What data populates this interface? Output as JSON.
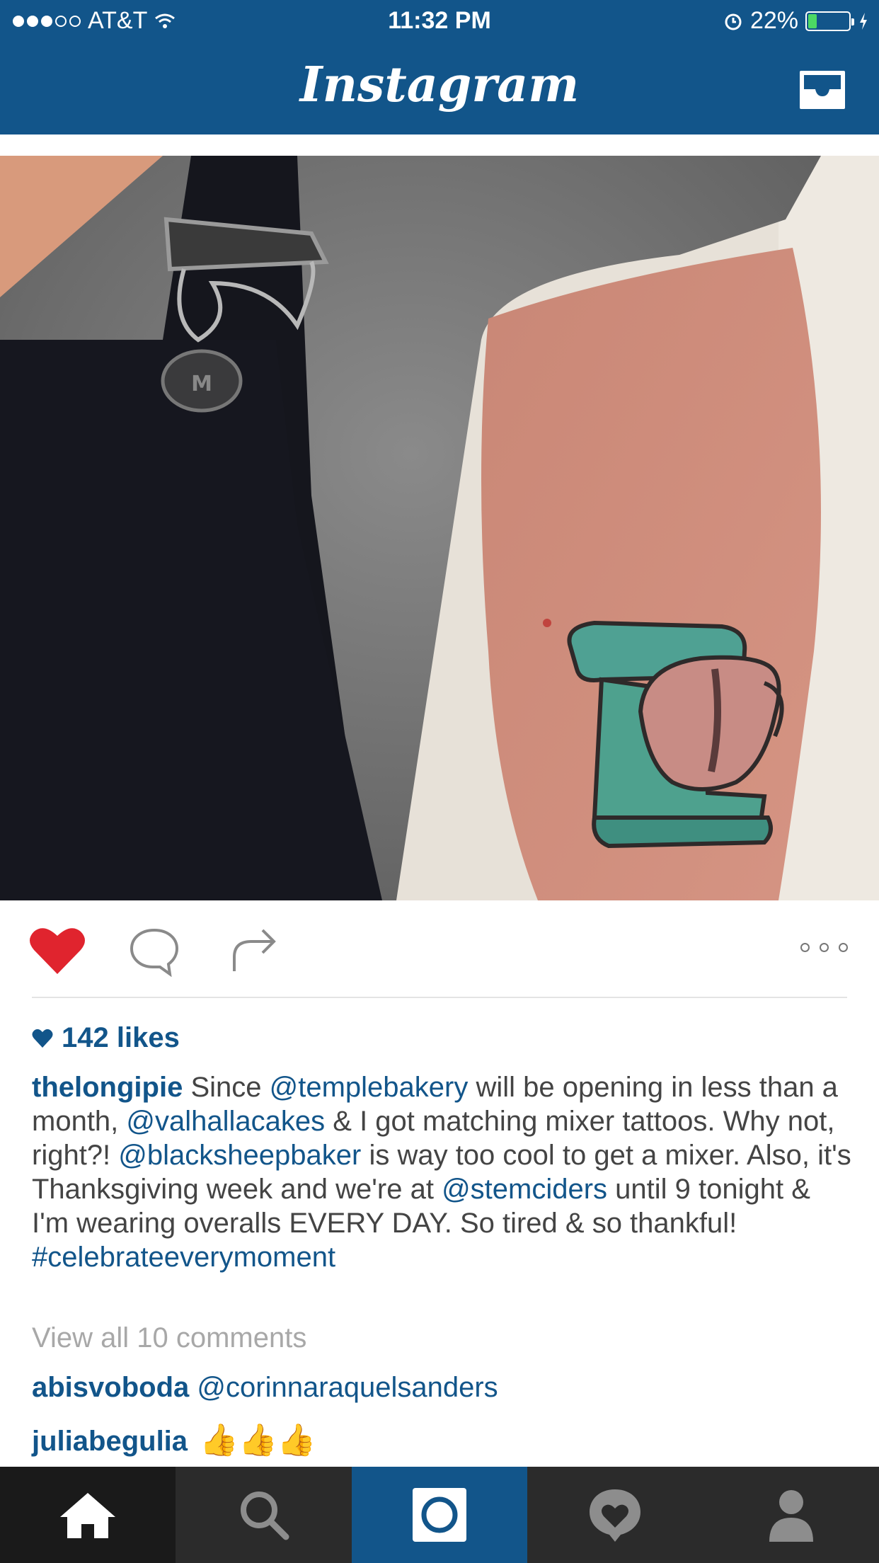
{
  "status_bar": {
    "carrier": "AT&T",
    "time": "11:32 PM",
    "battery": "22%",
    "battery_level": 0.22,
    "signal_bars": 3
  },
  "nav": {
    "title": "Instagram",
    "inbox_icon": "inbox-tray-icon"
  },
  "post": {
    "image_alt": "",
    "liked": true,
    "likes": "142 likes",
    "caption": {
      "author": "thelongipie",
      "p1": " Since ",
      "m1": "@templebakery",
      "p2": " will be opening in less than a month, ",
      "m2": "@valhallacakes",
      "p3": " & I got matching mixer tattoos.  Why not, right?! ",
      "m3": "@blacksheepbaker",
      "p4": " is way too cool to get a mixer.  Also, it's  Thanksgiving week and we're at ",
      "m4": "@stemciders",
      "p5": " until 9 tonight & I'm wearing overalls EVERY DAY.  So tired & so thankful! ",
      "tag": "#celebrateeverymoment"
    },
    "view_all": "View all 10 comments",
    "comments": [
      {
        "user": "abisvoboda",
        "text": "@corinnaraquelsanders"
      },
      {
        "user": "juliabegulia",
        "text": "👍👍👍"
      }
    ]
  },
  "tabs": [
    {
      "name": "home",
      "icon": "home-icon"
    },
    {
      "name": "search",
      "icon": "search-icon"
    },
    {
      "name": "camera",
      "icon": "camera-icon"
    },
    {
      "name": "activity",
      "icon": "heart-bubble-icon"
    },
    {
      "name": "profile",
      "icon": "person-icon"
    }
  ],
  "colors": {
    "brand": "#12558a",
    "like": "#e0242e",
    "battery": "#4cd964"
  }
}
